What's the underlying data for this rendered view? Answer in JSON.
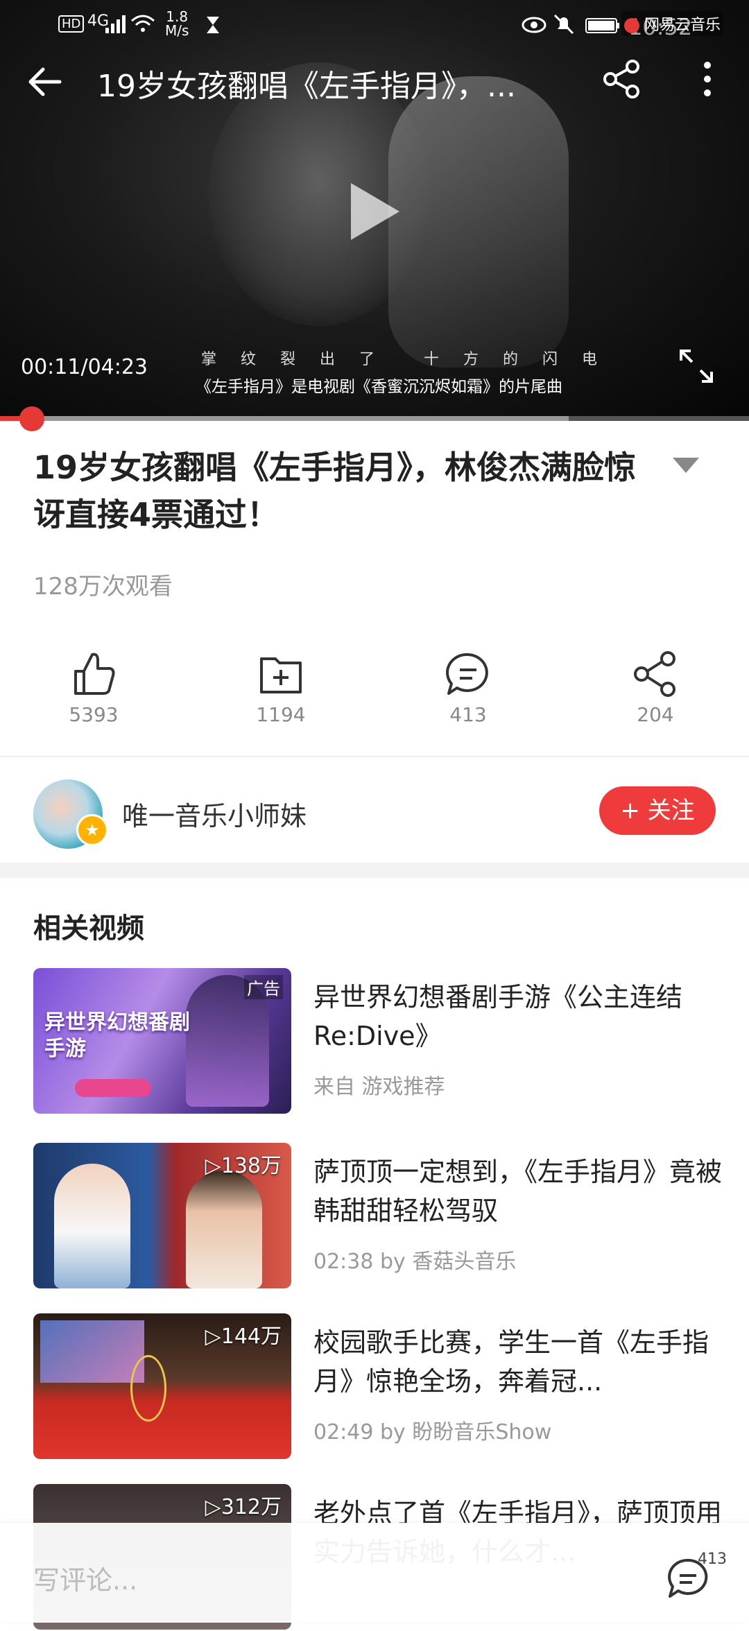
{
  "status_bar": {
    "network": "4G",
    "speed": "1.8",
    "speed_unit": "M/s",
    "time": "10:52",
    "app_badge": "网易云音乐"
  },
  "video": {
    "title": "19岁女孩翻唱《左手指月》，...",
    "current_time": "00:11/04:23",
    "lyric": "掌 纹 裂 出 了　 十 方 的 闪 电",
    "caption": "《左手指月》是电视剧《香蜜沉沉烬如霜》的片尾曲",
    "progress": 0.043
  },
  "detail": {
    "title": "19岁女孩翻唱《左手指月》，林俊杰满脸惊讶直接4票通过！",
    "views": "128万次观看"
  },
  "actions": [
    {
      "name": "like",
      "icon": "thumbs-up-icon",
      "count": "5393"
    },
    {
      "name": "collect",
      "icon": "folder-plus-icon",
      "count": "1194"
    },
    {
      "name": "comment",
      "icon": "comment-icon",
      "count": "413"
    },
    {
      "name": "share",
      "icon": "share-icon",
      "count": "204"
    }
  ],
  "author": {
    "name": "唯一音乐小师妹",
    "follow_label": "+ 关注"
  },
  "related": {
    "heading": "相关视频",
    "items": [
      {
        "title": "异世界幻想番剧手游《公主连结Re:Dive》",
        "meta": "来自 游戏推荐",
        "badge": "广告",
        "thumb_text": "异世界幻想番剧手游"
      },
      {
        "title": "萨顶顶一定想到，《左手指月》竟被韩甜甜轻松驾驭",
        "meta": "02:38 by 香菇头音乐",
        "plays": "▷138万"
      },
      {
        "title": "校园歌手比赛，学生一首《左手指月》惊艳全场，奔着冠...",
        "meta": "02:49 by 盼盼音乐Show",
        "plays": "▷144万"
      },
      {
        "title": "老外点了首《左手指月》，萨顶顶用实力告诉她，什么才...",
        "meta": "",
        "plays": "▷312万"
      }
    ]
  },
  "comment_bar": {
    "placeholder": "写评论...",
    "count": "413"
  },
  "colors": {
    "accent": "#ef3b3b",
    "text": "#222222",
    "muted": "#999999"
  }
}
